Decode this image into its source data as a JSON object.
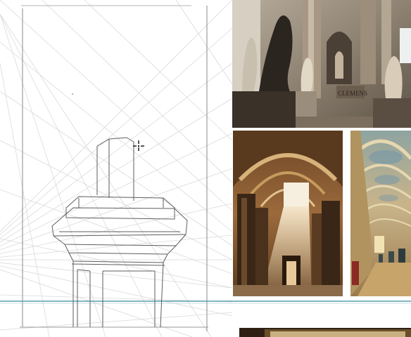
{
  "canvas": {
    "background": "#ffffff",
    "guide_line_color": "#d5d5d5",
    "sketch_stroke_color": "#5e5e5e",
    "horizon_guide_color": "#5a9fae"
  },
  "cursor": {
    "icon": "crosshair-move-icon"
  },
  "sketch": {
    "subject": "column-capital-perspective-sketch"
  },
  "reference_images": [
    {
      "name": "statue-gallery",
      "palette": [
        "#6b5d4e",
        "#c8bba8",
        "#2b251f"
      ]
    },
    {
      "name": "arched-hall",
      "palette": [
        "#8a5a2e",
        "#e8c79a",
        "#3a2616"
      ]
    },
    {
      "name": "long-corridor",
      "palette": [
        "#a58a5c",
        "#e6d7b0",
        "#4a6a7a"
      ]
    },
    {
      "name": "bottom-image",
      "palette": [
        "#3a2a18",
        "#6b4f2a"
      ]
    }
  ]
}
